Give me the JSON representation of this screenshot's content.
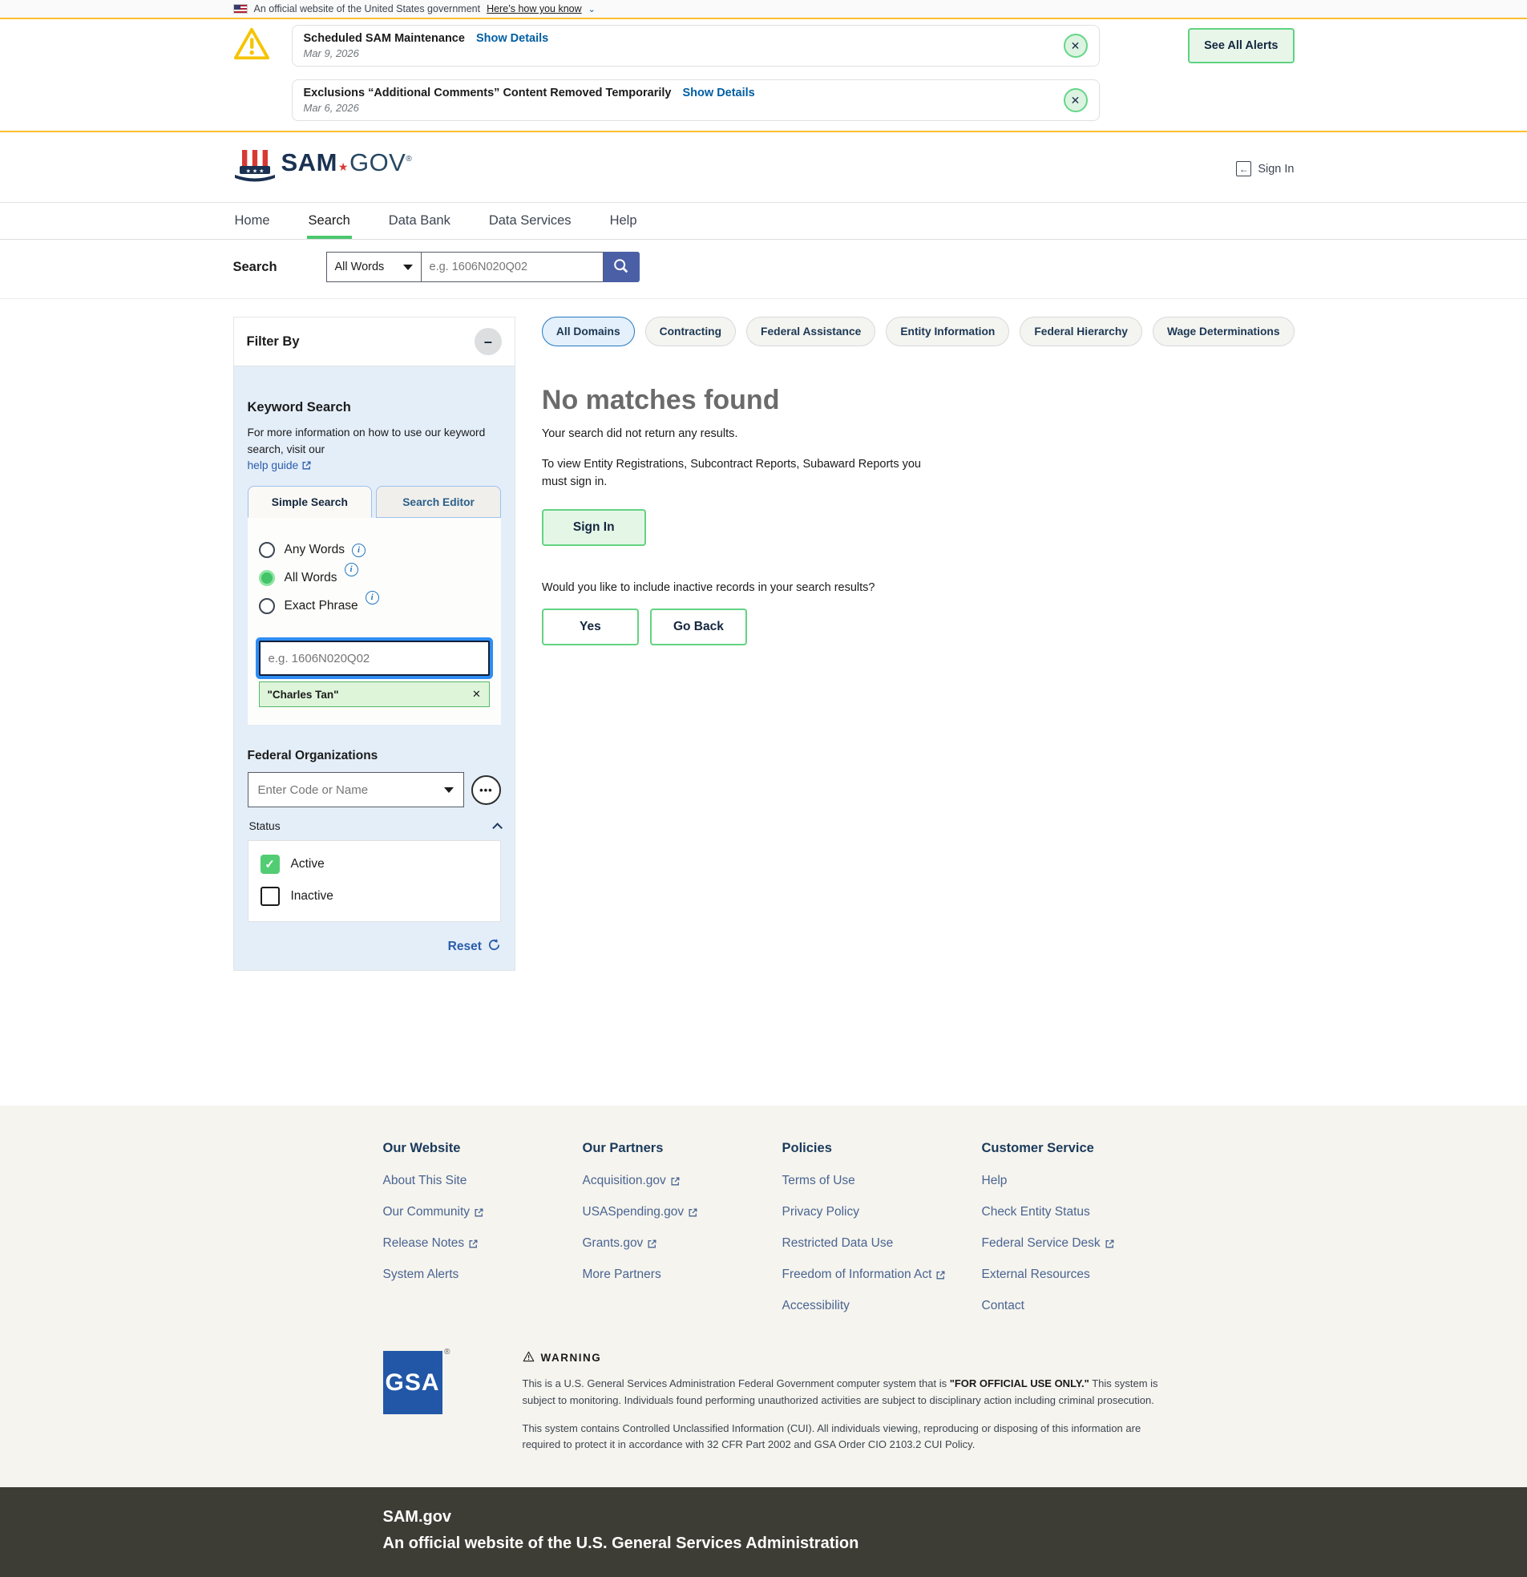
{
  "gov_banner": {
    "text": "An official website of the United States government",
    "link_label": "Here’s how you know",
    "chevron": "⌄"
  },
  "alerts": {
    "items": [
      {
        "title": "Scheduled SAM Maintenance",
        "details_label": "Show Details",
        "date": "Mar 9, 2026"
      },
      {
        "title": "Exclusions “Additional Comments” Content Removed Temporarily",
        "details_label": "Show Details",
        "date": "Mar 6, 2026"
      }
    ],
    "close_glyph": "✕",
    "see_all_label": "See All Alerts"
  },
  "header": {
    "logo_sam": "SAM",
    "logo_star": "★",
    "logo_gov": "GOV",
    "logo_reg": "®",
    "sign_in_label": "Sign In",
    "sign_in_arrow": "←"
  },
  "nav": {
    "items": [
      {
        "label": "Home",
        "active": false
      },
      {
        "label": "Search",
        "active": true
      },
      {
        "label": "Data Bank",
        "active": false
      },
      {
        "label": "Data Services",
        "active": false
      },
      {
        "label": "Help",
        "active": false
      }
    ]
  },
  "searchbar": {
    "label": "Search",
    "select_value": "All Words",
    "placeholder": "e.g. 1606N020Q02"
  },
  "filter": {
    "title": "Filter By",
    "collapse_glyph": "–",
    "keyword": {
      "heading": "Keyword Search",
      "info_text": "For more information on how to use our keyword search, visit our",
      "help_link_label": "help guide",
      "tabs": {
        "simple": "Simple Search",
        "editor": "Search Editor"
      },
      "radios": [
        {
          "label": "Any Words",
          "selected": false
        },
        {
          "label": "All Words",
          "selected": true
        },
        {
          "label": "Exact Phrase",
          "selected": false
        }
      ],
      "info_glyph": "i",
      "input_placeholder": "e.g. 1606N020Q02",
      "chip_label": "\"Charles Tan\"",
      "chip_remove_glyph": "✕"
    },
    "fed_org": {
      "heading": "Federal Organizations",
      "select_placeholder": "Enter Code or Name",
      "ellipsis_glyph": "•••"
    },
    "status": {
      "label": "Status",
      "options": [
        {
          "label": "Active",
          "checked": true
        },
        {
          "label": "Inactive",
          "checked": false
        }
      ],
      "check_glyph": "✓"
    },
    "reset_label": "Reset"
  },
  "results": {
    "domain_tabs": [
      {
        "label": "All Domains",
        "active": true
      },
      {
        "label": "Contracting",
        "active": false
      },
      {
        "label": "Federal Assistance",
        "active": false
      },
      {
        "label": "Entity Information",
        "active": false
      },
      {
        "label": "Federal Hierarchy",
        "active": false
      },
      {
        "label": "Wage Determinations",
        "active": false
      }
    ],
    "heading": "No matches found",
    "subtext": "Your search did not return any results.",
    "signin_note": "To view Entity Registrations, Subcontract Reports, Subaward Reports you must sign in.",
    "signin_button": "Sign In",
    "inactive_question": "Would you like to include inactive records in your search results?",
    "yes_button": "Yes",
    "goback_button": "Go Back"
  },
  "footer": {
    "columns": [
      {
        "heading": "Our Website",
        "links": [
          {
            "label": "About This Site",
            "external": false
          },
          {
            "label": "Our Community",
            "external": true
          },
          {
            "label": "Release Notes",
            "external": true
          },
          {
            "label": "System Alerts",
            "external": false
          }
        ]
      },
      {
        "heading": "Our Partners",
        "links": [
          {
            "label": "Acquisition.gov",
            "external": true
          },
          {
            "label": "USASpending.gov",
            "external": true
          },
          {
            "label": "Grants.gov",
            "external": true
          },
          {
            "label": "More Partners",
            "external": false
          }
        ]
      },
      {
        "heading": "Policies",
        "links": [
          {
            "label": "Terms of Use",
            "external": false
          },
          {
            "label": "Privacy Policy",
            "external": false
          },
          {
            "label": "Restricted Data Use",
            "external": false
          },
          {
            "label": "Freedom of Information Act",
            "external": true
          },
          {
            "label": "Accessibility",
            "external": false
          }
        ]
      },
      {
        "heading": "Customer Service",
        "links": [
          {
            "label": "Help",
            "external": false
          },
          {
            "label": "Check Entity Status",
            "external": false
          },
          {
            "label": "Federal Service Desk",
            "external": true
          },
          {
            "label": "External Resources",
            "external": false
          },
          {
            "label": "Contact",
            "external": false
          }
        ]
      }
    ],
    "gsa": {
      "logo_text": "GSA",
      "reg": "®"
    },
    "warning": {
      "heading": "WARNING",
      "p1_before": "This is a U.S. General Services Administration Federal Government computer system that is ",
      "p1_bold": "\"FOR OFFICIAL USE ONLY.\"",
      "p1_after": " This system is subject to monitoring. Individuals found performing unauthorized activities are subject to disciplinary action including criminal prosecution.",
      "p2": "This system contains Controlled Unclassified Information (CUI). All individuals viewing, reproducing or disposing of this information are required to protect it in accordance with 32 CFR Part 2002 and GSA Order CIO 2103.2 CUI Policy."
    }
  },
  "bottom_bar": {
    "title": "SAM.gov",
    "subtitle": "An official website of the U.S. General Services Administration"
  },
  "colors": {
    "gold_accent": "#ffbe2e",
    "green_accent": "#5fd27f",
    "green_fill": "#52cd74",
    "link_blue": "#005ea2",
    "search_button_blue": "#4a5fa5",
    "footer_link_blue": "#4a6492",
    "navy_text": "#1b3a5c",
    "dark_footer_bg": "#3e3d35",
    "filter_panel_bg": "#e4eef9"
  }
}
